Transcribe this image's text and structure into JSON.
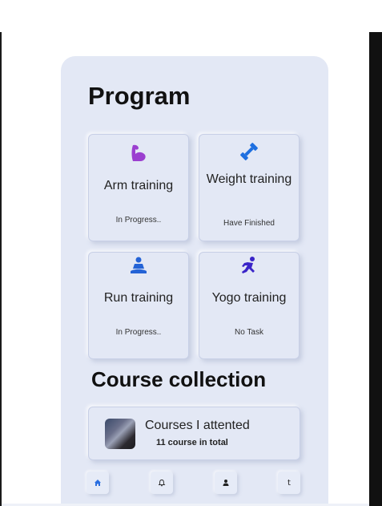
{
  "program": {
    "title": "Program",
    "cards": [
      {
        "name": "Arm training",
        "status": "In Progress..",
        "icon": "flexed-arm-icon",
        "color": "#9b3fd0"
      },
      {
        "name": "Weight training",
        "status": "Have Finished",
        "icon": "dumbbell-icon",
        "color": "#1e6fe0"
      },
      {
        "name": "Run training",
        "status": "In Progress..",
        "icon": "meditation-person-icon",
        "color": "#2463d6"
      },
      {
        "name": "Yogo training",
        "status": "No Task",
        "icon": "running-person-icon",
        "color": "#3a24c8"
      }
    ]
  },
  "courses": {
    "title": "Course collection",
    "item_title": "Courses I attented",
    "item_subtitle": "11 course in total"
  },
  "nav": {
    "items": [
      {
        "icon": "home-icon",
        "glyph": "⌂",
        "color": "#2b6fe0"
      },
      {
        "icon": "bell-icon",
        "glyph": "Δ",
        "color": "#222222"
      },
      {
        "icon": "user-icon",
        "glyph": "●",
        "color": "#222222"
      },
      {
        "icon": "t-icon",
        "glyph": "t",
        "color": "#222222"
      }
    ]
  }
}
